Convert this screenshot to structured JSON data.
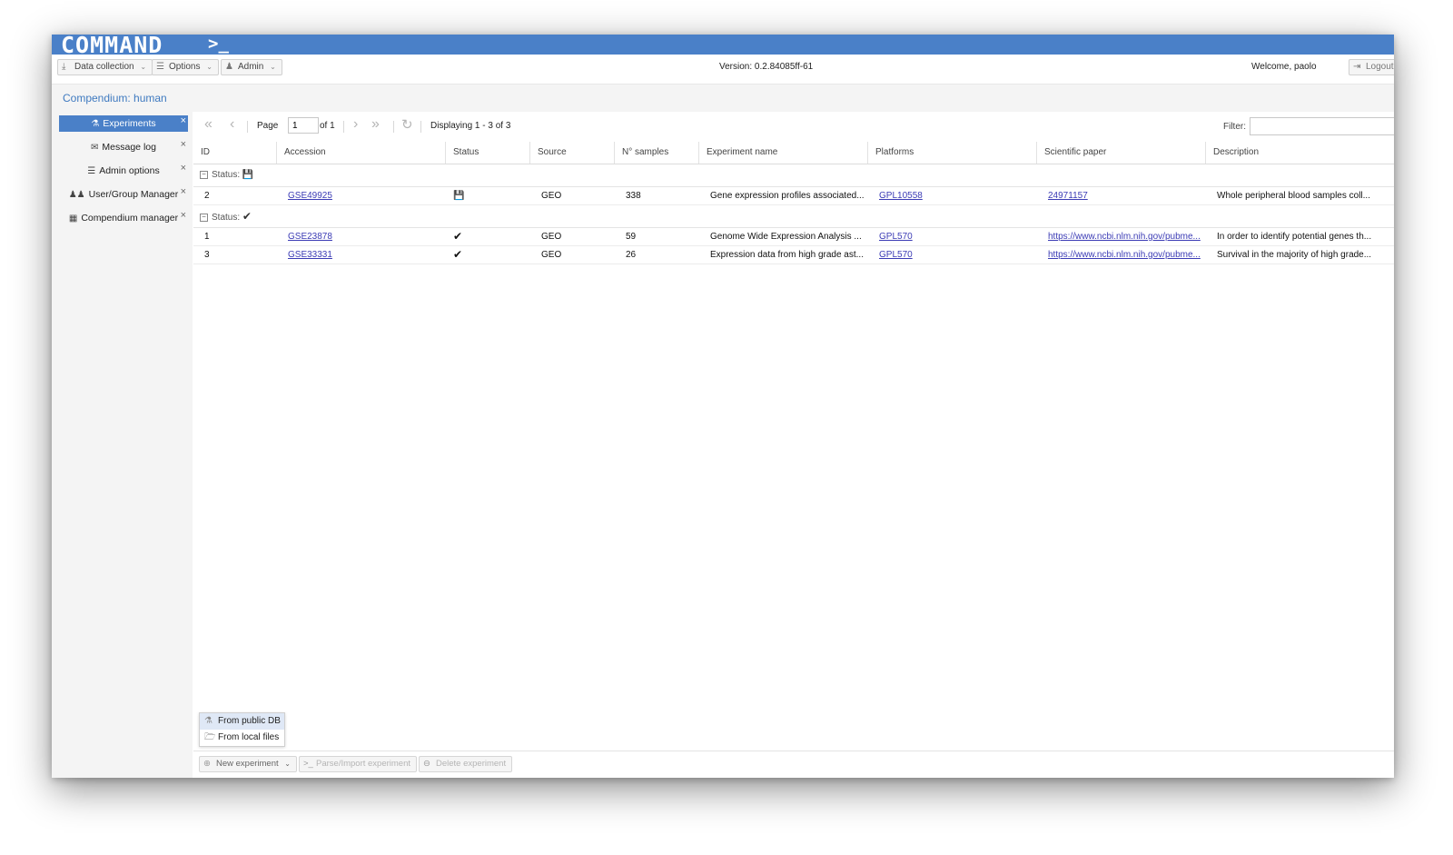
{
  "app": {
    "logo": "COMMAND",
    "prompt": ">_"
  },
  "toolbar": {
    "data_collection": "Data collection",
    "options": "Options",
    "admin": "Admin",
    "version": "Version: 0.2.84085ff-61",
    "welcome": "Welcome, paolo",
    "logout": "Logout"
  },
  "breadcrumb": "Compendium: human",
  "sidebar": {
    "items": [
      {
        "label": "Experiments",
        "icon": "flask-icon",
        "active": true
      },
      {
        "label": "Message log",
        "icon": "comments-icon",
        "active": false
      },
      {
        "label": "Admin options",
        "icon": "list-icon",
        "active": false
      },
      {
        "label": "User/Group Manager",
        "icon": "users-icon",
        "active": false
      },
      {
        "label": "Compendium manager",
        "icon": "grid-icon",
        "active": false
      }
    ]
  },
  "pager": {
    "page_label": "Page",
    "page_value": "1",
    "of_label": "of 1",
    "displaying": "Displaying 1 - 3 of 3",
    "filter_label": "Filter:"
  },
  "grid": {
    "columns": [
      "ID",
      "Accession",
      "Status",
      "Source",
      "N° samples",
      "Experiment name",
      "Platforms",
      "Scientific paper",
      "Description"
    ],
    "groups": [
      {
        "label": "Status:",
        "status_icon": "save-icon",
        "rows": [
          {
            "id": "2",
            "accession": "GSE49925",
            "status_icon": "save-icon",
            "source": "GEO",
            "samples": "338",
            "name": "Gene expression profiles associated...",
            "platforms": "GPL10558",
            "paper": "24971157",
            "description": "Whole peripheral blood samples coll..."
          }
        ]
      },
      {
        "label": "Status:",
        "status_icon": "check-icon",
        "rows": [
          {
            "id": "1",
            "accession": "GSE23878",
            "status_icon": "check-icon",
            "source": "GEO",
            "samples": "59",
            "name": "Genome Wide Expression Analysis ...",
            "platforms": "GPL570",
            "paper": "https://www.ncbi.nlm.nih.gov/pubme...",
            "description": "In order to identify potential genes th..."
          },
          {
            "id": "3",
            "accession": "GSE33331",
            "status_icon": "check-icon",
            "source": "GEO",
            "samples": "26",
            "name": "Expression data from high grade ast...",
            "platforms": "GPL570",
            "paper": "https://www.ncbi.nlm.nih.gov/pubme...",
            "description": "Survival in the majority of high grade..."
          }
        ]
      }
    ]
  },
  "new_menu": {
    "from_public_db": "From public DB",
    "from_local_files": "From local files"
  },
  "bottombar": {
    "new_experiment": "New experiment",
    "parse_import": "Parse/Import experiment",
    "delete_experiment": "Delete experiment"
  },
  "colors": {
    "accent": "#4a80c8",
    "link": "#3b3bb5"
  }
}
